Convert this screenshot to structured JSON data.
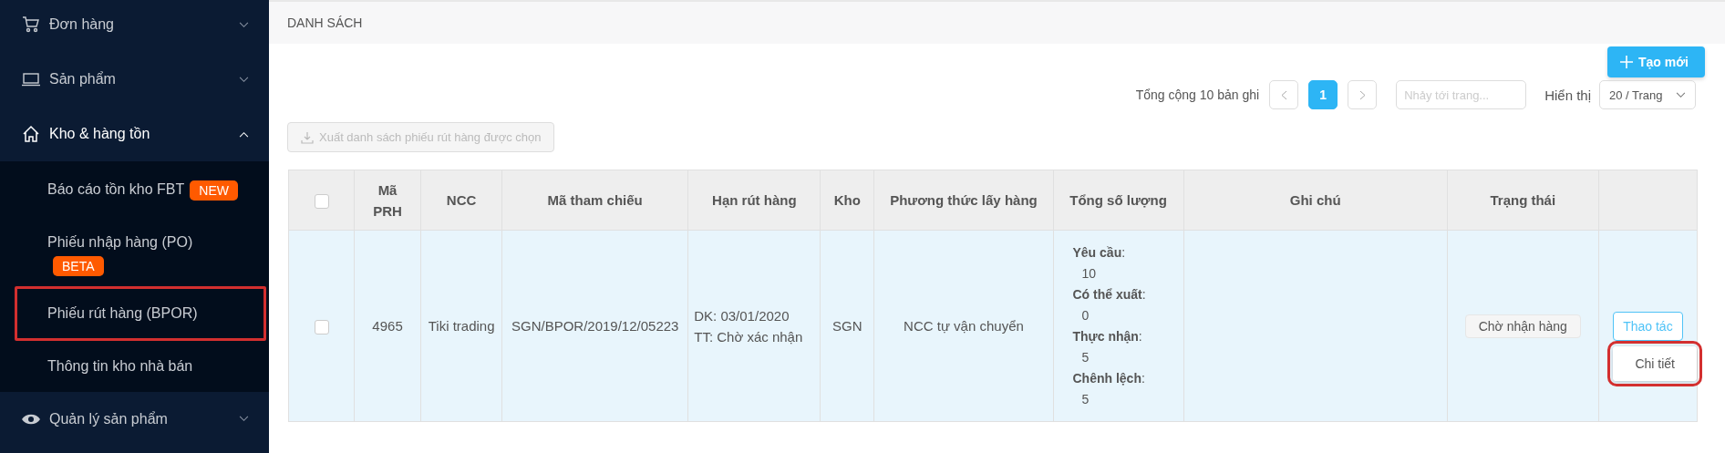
{
  "sidebar": {
    "items": [
      {
        "label": "Đơn hàng",
        "expanded": false
      },
      {
        "label": "Sản phẩm",
        "expanded": false
      },
      {
        "label": "Kho & hàng tồn",
        "expanded": true,
        "children": [
          {
            "label": "Báo cáo tồn kho FBT",
            "badge": "NEW",
            "outlined": false
          },
          {
            "label": "Phiếu nhập hàng (PO)",
            "badge": "BETA",
            "outlined": false
          },
          {
            "label": "Phiếu rút hàng (BPOR)",
            "outlined": true
          },
          {
            "label": "Thông tin kho nhà bán",
            "outlined": false
          }
        ]
      },
      {
        "label": "Quản lý sản phẩm",
        "expanded": false
      }
    ]
  },
  "header": {
    "title": "DANH SÁCH"
  },
  "create_button": {
    "label": "Tạo mới"
  },
  "pagination": {
    "total": "Tổng cộng 10 bản ghi",
    "pages": [
      {
        "label": "1",
        "selected": true
      }
    ],
    "jump_placeholder": "Nhảy tới trang...",
    "show_label": "Hiển thị",
    "page_size": "20 / Trang"
  },
  "export_button": {
    "label": "Xuất danh sách phiếu rút hàng được chọn",
    "disabled": true
  },
  "table": {
    "header_checked": false,
    "columns": [
      "Mã PRH",
      "NCC",
      "Mã tham chiếu",
      "Hạn rút hàng",
      "Kho",
      "Phương thức lấy hàng",
      "Tổng số lượng",
      "Ghi chú",
      "Trạng thái"
    ],
    "rows": [
      {
        "checked": false,
        "highlighted": true,
        "id": "4965",
        "supplier": "Tiki trading",
        "reference": "SGN/BPOR/2019/12/05223",
        "deadline": [
          "DK: 03/01/2020",
          "TT: Chờ xác nhận"
        ],
        "warehouse": "SGN",
        "method": "NCC tự vận chuyển",
        "quantities": [
          {
            "label": "**Yêu cầu**:",
            "value": "10"
          },
          {
            "label": "**Có thể xuất**:",
            "value": "0"
          },
          {
            "label": "**Thực nhận**:",
            "value": "5"
          },
          {
            "label": "**Chênh lệch**:",
            "value": "5"
          }
        ],
        "status": "Chờ nhận hàng",
        "action": "Thao tác",
        "menu": [
          {
            "label": "Chi tiết",
            "outlined": true
          }
        ]
      }
    ]
  }
}
